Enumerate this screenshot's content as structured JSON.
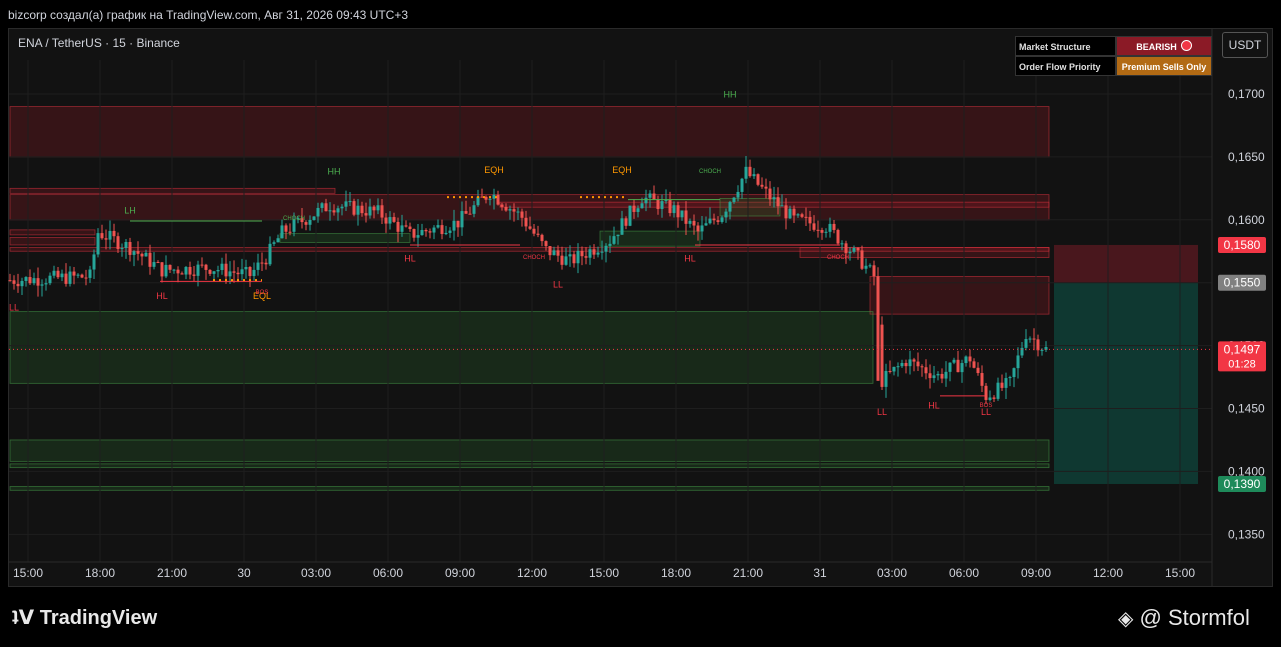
{
  "header": {
    "title": "bizcorp создал(а) график на TradingView.com, Авг 31, 2026 09:43 UTC+3",
    "symbol": "ENA / TetherUS · 15 · Binance",
    "currency": "USDT"
  },
  "infobox": {
    "rows": [
      {
        "label": "Market Structure",
        "value": "BEARISH",
        "color": "#8b1a26"
      },
      {
        "label": "Order Flow Priority",
        "value": "Premium Sells Only",
        "color": "#b26a14"
      }
    ]
  },
  "footer": {
    "brand": "TradingView",
    "author": "@ Stormfol"
  },
  "chart_data": {
    "type": "candlestick",
    "x_ticks": [
      "15:00",
      "18:00",
      "21:00",
      "30",
      "03:00",
      "06:00",
      "09:00",
      "12:00",
      "15:00",
      "18:00",
      "21:00",
      "31",
      "03:00",
      "06:00",
      "09:00",
      "12:00",
      "15:00"
    ],
    "y_ticks": [
      "0,1700",
      "0,1650",
      "0,1600",
      "0,1550",
      "0,1500",
      "0,1450",
      "0,1400",
      "0,1350"
    ],
    "ylim": [
      0.1328,
      0.1727
    ],
    "price_labels": [
      {
        "text": "0,1580",
        "price": 0.158,
        "color": "#f23645"
      },
      {
        "text": "0,1550",
        "price": 0.155,
        "color": "#808080"
      },
      {
        "text": "0,1497",
        "price": 0.1497,
        "color": "#f23645",
        "sub": "01:28"
      },
      {
        "text": "0,1390",
        "price": 0.139,
        "color": "#1e8a5a"
      }
    ],
    "structure_labels": [
      {
        "text": "LL",
        "t": 1,
        "price": 0.1528,
        "color": "#f23645"
      },
      {
        "text": "LH",
        "t": 30,
        "price": 0.1605,
        "color": "#4caf50"
      },
      {
        "text": "HL",
        "t": 38,
        "price": 0.1537,
        "color": "#f23645"
      },
      {
        "text": "EQL",
        "t": 63,
        "price": 0.1537,
        "color": "#ff9800"
      },
      {
        "text": "HH",
        "t": 81,
        "price": 0.1636,
        "color": "#4caf50"
      },
      {
        "text": "HL",
        "t": 100,
        "price": 0.1567,
        "color": "#f23645"
      },
      {
        "text": "EQH",
        "t": 121,
        "price": 0.1637,
        "color": "#ff9800"
      },
      {
        "text": "LL",
        "t": 137,
        "price": 0.1546,
        "color": "#f23645"
      },
      {
        "text": "EQH",
        "t": 153,
        "price": 0.1637,
        "color": "#ff9800"
      },
      {
        "text": "HL",
        "t": 170,
        "price": 0.1567,
        "color": "#f23645"
      },
      {
        "text": "HH",
        "t": 180,
        "price": 0.1697,
        "color": "#4caf50"
      },
      {
        "text": "LL",
        "t": 218,
        "price": 0.1445,
        "color": "#f23645"
      },
      {
        "text": "HL",
        "t": 231,
        "price": 0.145,
        "color": "#f23645"
      },
      {
        "text": "LL",
        "t": 244,
        "price": 0.1445,
        "color": "#f23645"
      }
    ],
    "mini_labels": [
      {
        "text": "CHOCH",
        "t": 71,
        "price": 0.16,
        "color": "#4caf50"
      },
      {
        "text": "BOS",
        "t": 63,
        "price": 0.1541,
        "color": "#f23645"
      },
      {
        "text": "CHOCH",
        "t": 131,
        "price": 0.1569,
        "color": "#f23645"
      },
      {
        "text": "CHOCH",
        "t": 175,
        "price": 0.1637,
        "color": "#4caf50"
      },
      {
        "text": "CHOCH",
        "t": 207,
        "price": 0.1569,
        "color": "#f23645"
      },
      {
        "text": "BOS",
        "t": 244,
        "price": 0.1451,
        "color": "#f23645"
      }
    ],
    "colors": {
      "up": "#26a69a",
      "down": "#ef5350",
      "bearish": "#8b1a26",
      "premium": "#b26a14"
    }
  }
}
